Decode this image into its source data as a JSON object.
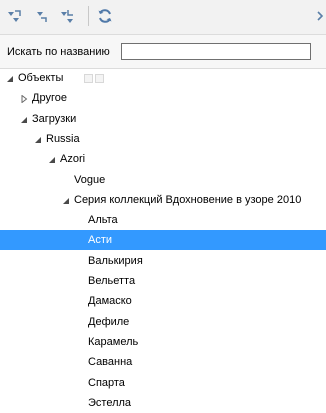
{
  "toolbar": {
    "buttons": [
      {
        "icon": "expand-all-icon"
      },
      {
        "icon": "collapse-icon"
      },
      {
        "icon": "collapse-all-icon"
      },
      {
        "icon": "refresh-icon"
      }
    ]
  },
  "search": {
    "label": "Искать по названию",
    "value": "",
    "placeholder": ""
  },
  "tree": {
    "nodes": [
      {
        "label": "Объекты",
        "level": 0,
        "state": "expanded"
      },
      {
        "label": "Другое",
        "level": 1,
        "state": "collapsed"
      },
      {
        "label": "Загрузки",
        "level": 1,
        "state": "expanded"
      },
      {
        "label": "Russia",
        "level": 2,
        "state": "expanded"
      },
      {
        "label": "Azori",
        "level": 3,
        "state": "expanded"
      },
      {
        "label": "Vogue",
        "level": 4,
        "state": "leaf"
      },
      {
        "label": "Серия коллекций Вдохновение в узоре 2010",
        "level": 4,
        "state": "expanded"
      },
      {
        "label": "Альта",
        "level": 5,
        "state": "leaf"
      },
      {
        "label": "Асти",
        "level": 5,
        "state": "leaf",
        "selected": true
      },
      {
        "label": "Валькирия",
        "level": 5,
        "state": "leaf"
      },
      {
        "label": "Вельетта",
        "level": 5,
        "state": "leaf"
      },
      {
        "label": "Дамаско",
        "level": 5,
        "state": "leaf"
      },
      {
        "label": "Дефиле",
        "level": 5,
        "state": "leaf"
      },
      {
        "label": "Карамель",
        "level": 5,
        "state": "leaf"
      },
      {
        "label": "Саванна",
        "level": 5,
        "state": "leaf"
      },
      {
        "label": "Спарта",
        "level": 5,
        "state": "leaf"
      },
      {
        "label": "Эстелла",
        "level": 5,
        "state": "leaf"
      }
    ]
  },
  "colors": {
    "selection": "#3399ff",
    "toolbar_icon": "#5a7fa8",
    "arrow": "#4a4a4a"
  }
}
